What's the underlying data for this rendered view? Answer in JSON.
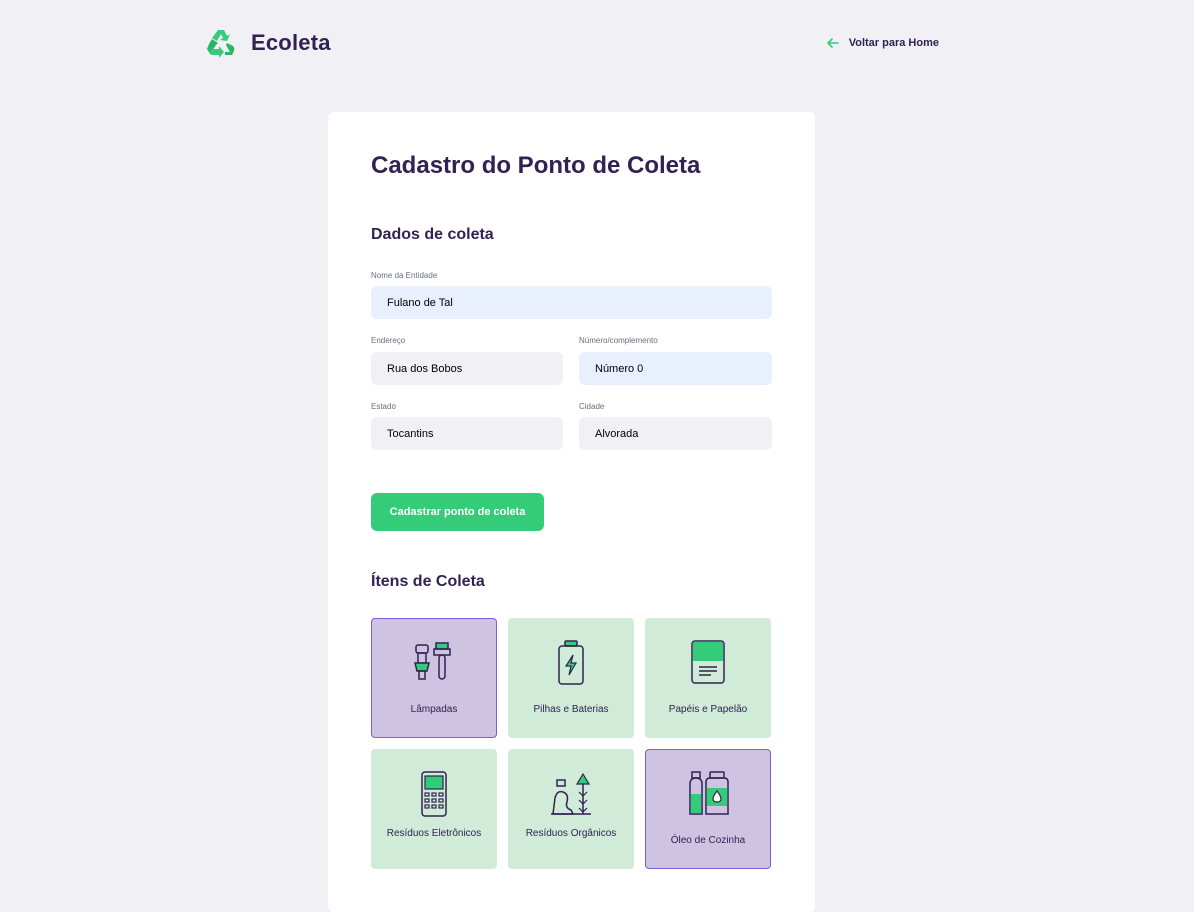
{
  "header": {
    "app_name": "Ecoleta",
    "back_label": "Voltar para Home"
  },
  "form": {
    "title": "Cadastro do Ponto de Coleta",
    "section_data_title": "Dados de coleta",
    "fields": {
      "entity_name": {
        "label": "Nome da Entidade",
        "value": "Fulano de Tal"
      },
      "address": {
        "label": "Endereço",
        "value": "Rua dos Bobos"
      },
      "number": {
        "label": "Número/complemento",
        "value": "Número 0"
      },
      "state": {
        "label": "Estado",
        "value": "Tocantins"
      },
      "city": {
        "label": "Cidade",
        "value": "Alvorada"
      }
    },
    "submit_label": "Cadastrar ponto de coleta",
    "section_items_title": "Ítens de Coleta",
    "items": [
      {
        "label": "Lâmpadas",
        "icon": "light-bulbs-icon",
        "selected": true
      },
      {
        "label": "Pilhas e Baterias",
        "icon": "battery-icon",
        "selected": false
      },
      {
        "label": "Papéis e Papelão",
        "icon": "paper-icon",
        "selected": false
      },
      {
        "label": "Resíduos Eletrônicos",
        "icon": "electronics-icon",
        "selected": false
      },
      {
        "label": "Resíduos Orgânicos",
        "icon": "organic-waste-icon",
        "selected": false
      },
      {
        "label": "Óleo de Cozinha",
        "icon": "cooking-oil-icon",
        "selected": true
      }
    ]
  },
  "colors": {
    "primary_green": "#34cb79",
    "title_purple": "#322153",
    "background": "#f0f0f5",
    "item_bg": "#d0ecd8",
    "item_selected_bg": "#cec3e0",
    "item_selected_border": "#7e5ed8"
  }
}
